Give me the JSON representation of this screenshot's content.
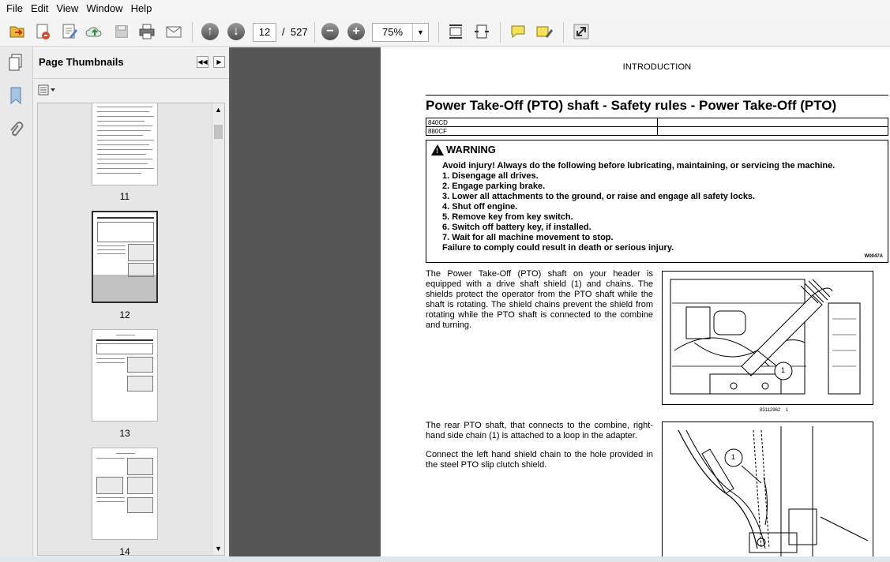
{
  "menu": [
    "File",
    "Edit",
    "View",
    "Window",
    "Help"
  ],
  "toolbar": {
    "icons": [
      "open-icon",
      "export-icon",
      "edit-icon",
      "upload-cloud-icon",
      "save-icon",
      "print-icon",
      "email-icon",
      "prev-page-icon",
      "next-page-icon",
      "zoom-out-icon",
      "zoom-in-icon",
      "fit-page-icon",
      "fit-width-icon",
      "comment-icon",
      "highlight-icon",
      "fullscreen-icon"
    ],
    "current_page": "12",
    "page_separator": "/",
    "total_pages": "527",
    "zoom": "75%"
  },
  "panel": {
    "title": "Page Thumbnails",
    "thumbnails": [
      {
        "label": "11"
      },
      {
        "label": "12"
      },
      {
        "label": "13"
      },
      {
        "label": "14"
      }
    ]
  },
  "document": {
    "header": "INTRODUCTION",
    "title": "Power Take-Off (PTO) shaft - Safety rules - Power Take-Off (PTO)",
    "models": [
      "840CD",
      "880CF"
    ],
    "warning": {
      "heading": "WARNING",
      "lines": [
        "Avoid injury! Always do the following before lubricating, maintaining, or servicing the machine.",
        "1.  Disengage all drives.",
        "2.  Engage parking brake.",
        "3.  Lower all attachments to the ground, or raise and engage all safety locks.",
        "4.  Shut off engine.",
        "5.  Remove key from key switch.",
        "6.  Switch off battery key, if installed.",
        "7.  Wait for all machine movement to stop.",
        "Failure to comply could result in death or serious injury."
      ],
      "code": "W0047A"
    },
    "paragraph1": "The Power Take-Off (PTO) shaft on your header is equipped with a drive shaft shield (1) and chains. The shields protect the operator from the PTO shaft while the shaft is rotating. The shield chains prevent the shield from rotating while the PTO shaft is connected to the combine and turning.",
    "figure1_caption_code": "83112962",
    "figure1_caption_num": "1",
    "figure_callout": "1",
    "paragraph2": "The rear PTO shaft, that connects to the combine, right-hand side chain (1) is attached to a loop in the adapter.",
    "paragraph3": "Connect the left hand shield chain to the hole provided in the steel PTO slip clutch shield."
  }
}
